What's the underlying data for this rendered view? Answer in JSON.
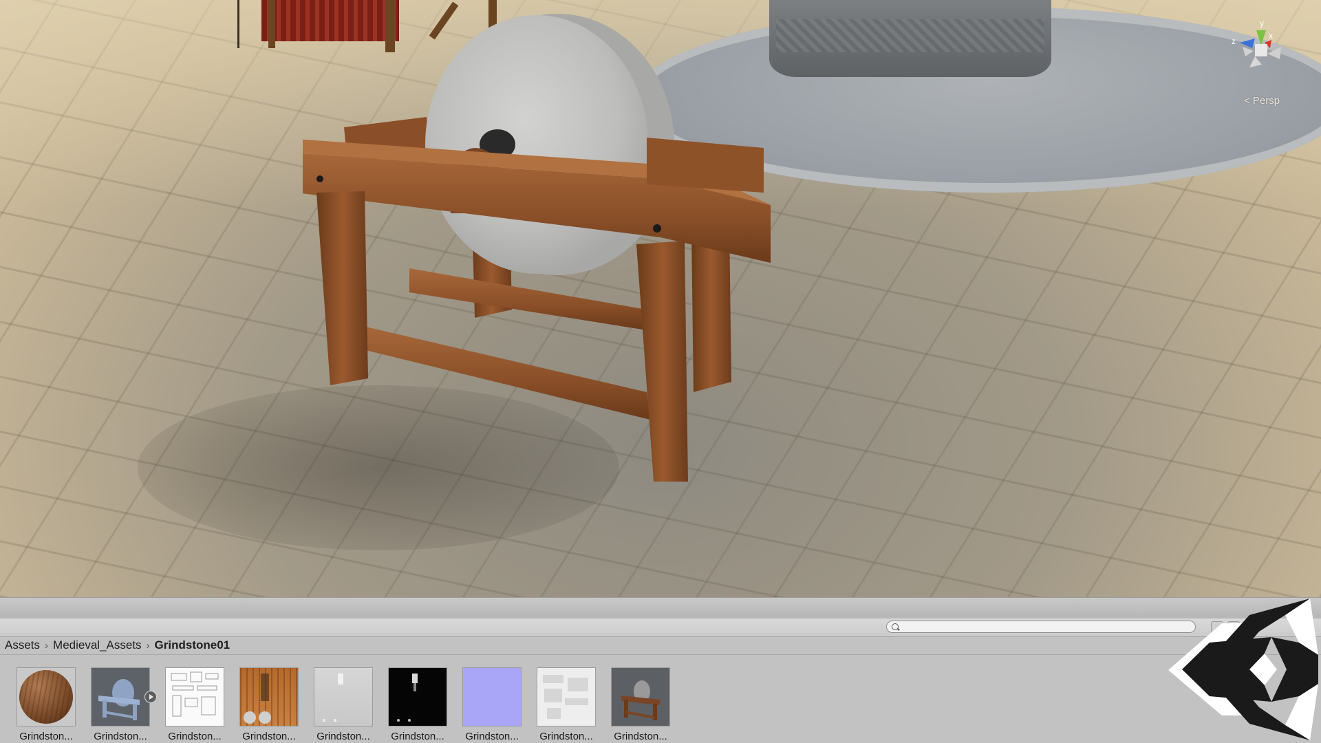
{
  "scene": {
    "view_mode_label": "< Persp",
    "gizmo": {
      "axes": [
        "y",
        "z",
        "x"
      ],
      "colors": {
        "y": "#7bc142",
        "x": "#d9392b",
        "z": "#3a72d8"
      }
    }
  },
  "project_panel": {
    "search": {
      "value": "",
      "placeholder": ""
    },
    "breadcrumb": [
      "Assets",
      "Medieval_Assets",
      "Grindstone01"
    ],
    "assets": [
      {
        "label": "Grindston...",
        "kind": "material-sphere"
      },
      {
        "label": "Grindston...",
        "kind": "model"
      },
      {
        "label": "Grindston...",
        "kind": "uv-texture"
      },
      {
        "label": "Grindston...",
        "kind": "albedo-texture"
      },
      {
        "label": "Grindston...",
        "kind": "gray-texture"
      },
      {
        "label": "Grindston...",
        "kind": "mask-texture"
      },
      {
        "label": "Grindston...",
        "kind": "normal-map"
      },
      {
        "label": "Grindston...",
        "kind": "occlusion-texture"
      },
      {
        "label": "Grindston...",
        "kind": "prefab"
      }
    ]
  },
  "colors": {
    "panel_bg": "#c2c2c2",
    "wood": "#8a4f28",
    "stone": "#c4c4c2",
    "normal_map": "#a9a6f7"
  }
}
